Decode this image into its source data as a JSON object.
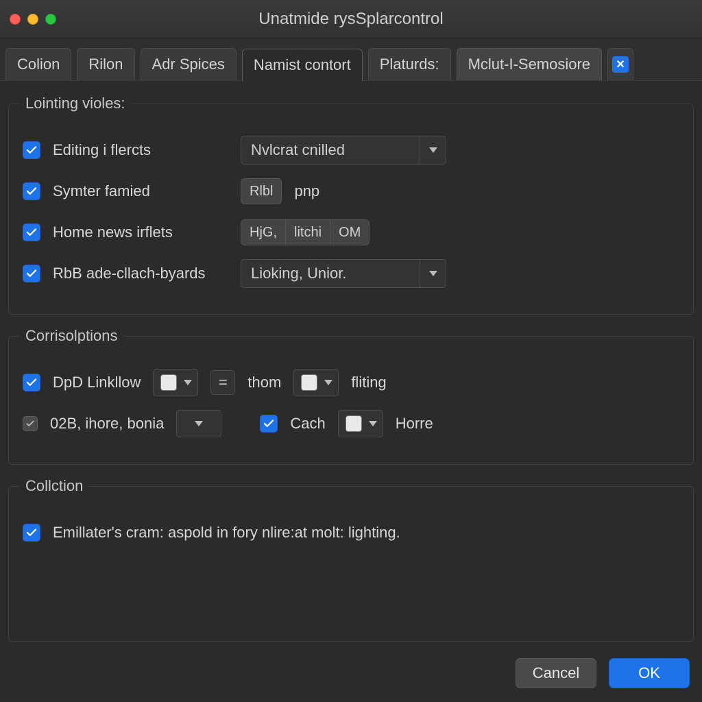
{
  "window": {
    "title": "Unatmide rysSplarcontrol"
  },
  "colors": {
    "accent": "#1e73e8",
    "window_bg": "#2b2b2b",
    "panel_border": "#3e3e3e"
  },
  "traffic_lights": {
    "close": "#ff5f57",
    "minimize": "#febc2e",
    "zoom": "#28c840"
  },
  "tabs": [
    {
      "label": "Colion"
    },
    {
      "label": "Rilon"
    },
    {
      "label": "Adr Spices"
    },
    {
      "label": "Namist contort",
      "active": true
    },
    {
      "label": "Platurds:"
    },
    {
      "label": "Mclut-I-Semosiore",
      "pill": true
    },
    {
      "icon": "close-icon",
      "icon_glyph": "✕",
      "blue_badge": true
    }
  ],
  "groups": {
    "lointing": {
      "title": "Lointing violes:",
      "rows": [
        {
          "id": "editing",
          "checked": true,
          "label": "Editing i flercts",
          "control": {
            "type": "combo",
            "value": "Nvlcrat cnilled"
          }
        },
        {
          "id": "symter",
          "checked": true,
          "label": "Symter famied",
          "control": {
            "type": "chips",
            "chips": [
              "Rlbl"
            ],
            "suffix": "pnp"
          }
        },
        {
          "id": "homenews",
          "checked": true,
          "label": "Home news irflets",
          "control": {
            "type": "chips-wide",
            "chips": [
              "HjG,",
              "litchi",
              "OM"
            ]
          }
        },
        {
          "id": "rbb",
          "checked": true,
          "label": "RbB ade-cllach-byards",
          "control": {
            "type": "combo",
            "value": "Lioking, Unior."
          }
        }
      ]
    },
    "corrisolptions": {
      "title": "Corrisolptions",
      "row1": {
        "chk": true,
        "label": "DpD Linkllow",
        "color1": "#e9e9e9",
        "op": "=",
        "mid_label": "thom",
        "color2": "#e9e9e9",
        "end_label": "fliting"
      },
      "row2": {
        "small_chk": true,
        "left_label": "02B, ihore, bonia",
        "left_color": "#bfbfbf",
        "cach_chk": true,
        "cach_label": "Cach",
        "cach_color": "#e9e9e9",
        "end_label": "Horre"
      }
    },
    "collction": {
      "title": "Collction",
      "chk": true,
      "label": "Emillater's cram: aspold in fory nlire:at molt: lighting."
    }
  },
  "footer": {
    "cancel": "Cancel",
    "ok": "OK"
  }
}
